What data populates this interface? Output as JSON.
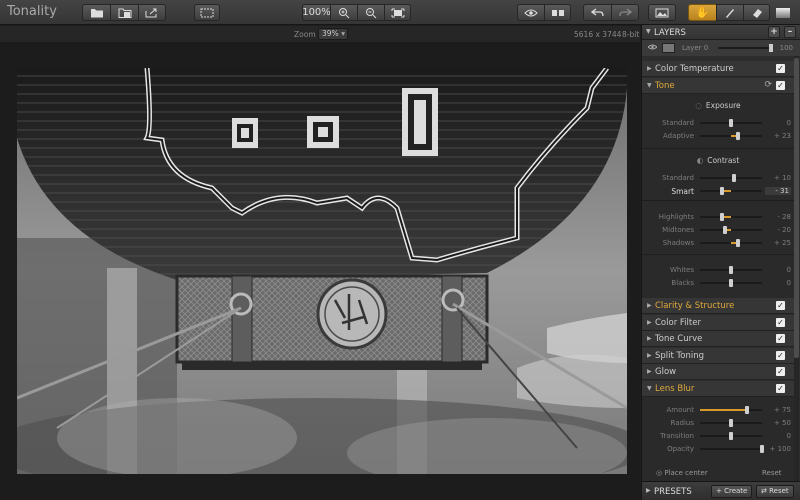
{
  "app": {
    "title": "Tonality"
  },
  "toolbar": {
    "zoom_value": "100%"
  },
  "subbar": {
    "zoom_label": "Zoom",
    "zoom_select_value": "39%",
    "image_dimensions": "5616 x 3744",
    "bit_depth": "8-bit"
  },
  "panel": {
    "layers": {
      "title": "LAYERS",
      "add_label": "+",
      "remove_label": "–",
      "items": [
        {
          "name": "Layer 0",
          "opacity": "100"
        }
      ]
    },
    "sections": {
      "color_temperature": {
        "label": "Color Temperature",
        "enabled": true
      },
      "tone": {
        "label": "Tone",
        "enabled": true,
        "exposure": {
          "title": "Exposure",
          "sliders": [
            {
              "label": "Standard",
              "value": "0",
              "position": 0.5
            },
            {
              "label": "Adaptive",
              "value": "+ 23",
              "position": 0.62
            }
          ]
        },
        "contrast": {
          "title": "Contrast",
          "sliders": [
            {
              "label": "Standard",
              "value": "+ 10",
              "position": 0.55
            },
            {
              "label": "Smart",
              "value": "- 31",
              "position": 0.35
            }
          ]
        },
        "hms": [
          {
            "label": "Highlights",
            "value": "- 28",
            "position": 0.36
          },
          {
            "label": "Midtones",
            "value": "- 20",
            "position": 0.4
          },
          {
            "label": "Shadows",
            "value": "+ 25",
            "position": 0.62
          }
        ],
        "wb": [
          {
            "label": "Whites",
            "value": "0",
            "position": 0.5
          },
          {
            "label": "Blacks",
            "value": "0",
            "position": 0.5
          }
        ]
      },
      "clarity": {
        "label": "Clarity & Structure",
        "enabled": true
      },
      "color_filter": {
        "label": "Color Filter",
        "enabled": true
      },
      "tone_curve": {
        "label": "Tone Curve",
        "enabled": true
      },
      "split_toning": {
        "label": "Split Toning",
        "enabled": true
      },
      "glow": {
        "label": "Glow",
        "enabled": true
      },
      "lens_blur": {
        "label": "Lens Blur",
        "enabled": true,
        "sliders": [
          {
            "label": "Amount",
            "value": "+ 75",
            "position": 0.75
          },
          {
            "label": "Radius",
            "value": "+ 50",
            "position": 0.5
          },
          {
            "label": "Transition",
            "value": "0",
            "position": 0.5
          },
          {
            "label": "Opacity",
            "value": "+ 100",
            "position": 1.0
          }
        ],
        "place_center_label": "Place center",
        "reset_label": "Reset"
      }
    },
    "presets": {
      "title": "PRESETS",
      "create_label": "Create",
      "reset_label": "Reset"
    }
  },
  "colors": {
    "accent": "#e0a93a",
    "panel_bg": "#2d2d2d",
    "toolbar_bg": "#3c3c3c"
  }
}
